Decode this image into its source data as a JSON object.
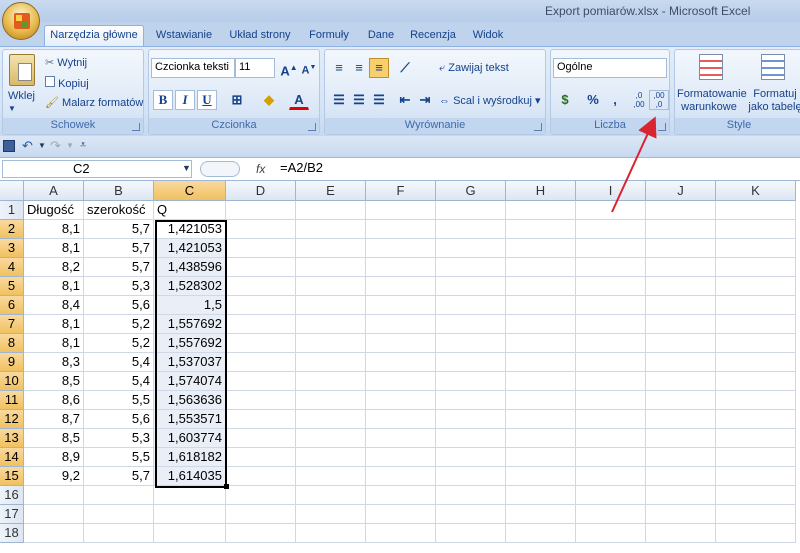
{
  "window": {
    "title": "Export pomiarów.xlsx - Microsoft Excel"
  },
  "tabs": [
    "Narzędzia główne",
    "Wstawianie",
    "Układ strony",
    "Formuły",
    "Dane",
    "Recenzja",
    "Widok"
  ],
  "clipboard": {
    "paste": "Wklej",
    "cut": "Wytnij",
    "copy": "Kopiuj",
    "format_painter": "Malarz formatów",
    "label": "Schowek"
  },
  "font": {
    "name": "Czcionka teksti",
    "size": "11",
    "bold": "B",
    "italic": "I",
    "underline": "U",
    "label": "Czcionka"
  },
  "alignment": {
    "wrap": "Zawijaj tekst",
    "merge": "Scal i wyśrodkuj",
    "label": "Wyrównanie"
  },
  "number": {
    "format": "Ogólne",
    "percent": "%",
    "comma": ",",
    "inc_decimal": ",0 ,00",
    "dec_decimal": ",00 ,0",
    "label": "Liczba"
  },
  "styles": {
    "conditional": "Formatowanie warunkowe",
    "table": "Formatuj jako tabelę",
    "label": "Style"
  },
  "formula_bar": {
    "cell_ref": "C2",
    "fx": "fx",
    "formula": "=A2/B2"
  },
  "columns": [
    "A",
    "B",
    "C",
    "D",
    "E",
    "F",
    "G",
    "H",
    "I",
    "J",
    "K"
  ],
  "rows": [
    "1",
    "2",
    "3",
    "4",
    "5",
    "6",
    "7",
    "8",
    "9",
    "10",
    "11",
    "12",
    "13",
    "14",
    "15",
    "16",
    "17",
    "18"
  ],
  "sheet": [
    [
      "Długość",
      "szerokość",
      "Q"
    ],
    [
      "8,1",
      "5,7",
      "1,421053"
    ],
    [
      "8,1",
      "5,7",
      "1,421053"
    ],
    [
      "8,2",
      "5,7",
      "1,438596"
    ],
    [
      "8,1",
      "5,3",
      "1,528302"
    ],
    [
      "8,4",
      "5,6",
      "1,5"
    ],
    [
      "8,1",
      "5,2",
      "1,557692"
    ],
    [
      "8,1",
      "5,2",
      "1,557692"
    ],
    [
      "8,3",
      "5,4",
      "1,537037"
    ],
    [
      "8,5",
      "5,4",
      "1,574074"
    ],
    [
      "8,6",
      "5,5",
      "1,563636"
    ],
    [
      "8,7",
      "5,6",
      "1,553571"
    ],
    [
      "8,5",
      "5,3",
      "1,603774"
    ],
    [
      "8,9",
      "5,5",
      "1,618182"
    ],
    [
      "9,2",
      "5,7",
      "1,614035"
    ]
  ],
  "annotation": {
    "arrow_color": "#d9252f"
  }
}
